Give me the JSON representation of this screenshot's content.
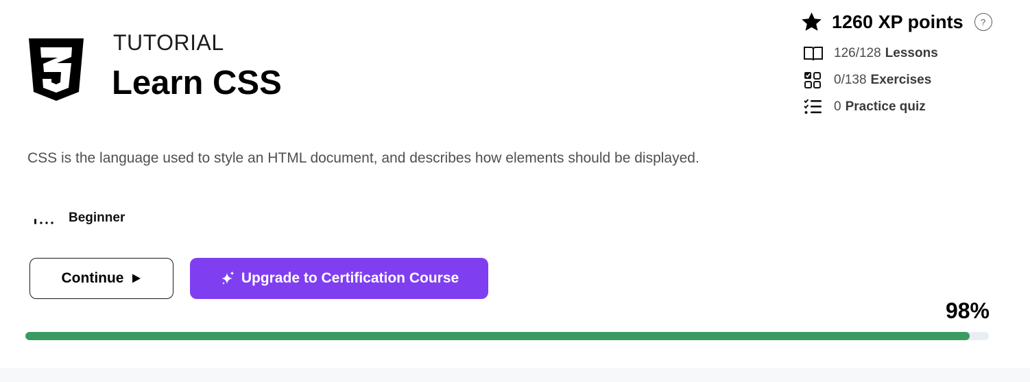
{
  "header": {
    "kicker": "TUTORIAL",
    "title": "Learn CSS",
    "logo_icon": "css3-shield-icon"
  },
  "stats": {
    "xp_text": "1260 XP points",
    "xp_icon": "star-icon",
    "help_glyph": "?",
    "items": [
      {
        "icon": "book-icon",
        "value": "126/128",
        "label": "Lessons"
      },
      {
        "icon": "exercises-grid-icon",
        "value": "0/138",
        "label": "Exercises"
      },
      {
        "icon": "checklist-icon",
        "value": "0",
        "label": "Practice quiz"
      }
    ]
  },
  "description": "CSS is the language used to style an HTML document, and describes how elements should be displayed.",
  "level": {
    "label": "Beginner",
    "icon": "level-bars-icon"
  },
  "buttons": {
    "continue_label": "Continue",
    "upgrade_label": "Upgrade to Certification Course"
  },
  "progress": {
    "percent_label": "98%",
    "value": 0.98
  },
  "colors": {
    "accent_purple": "#7f3ff0",
    "progress_green": "#3a9b62",
    "progress_track": "#e8eef3"
  }
}
